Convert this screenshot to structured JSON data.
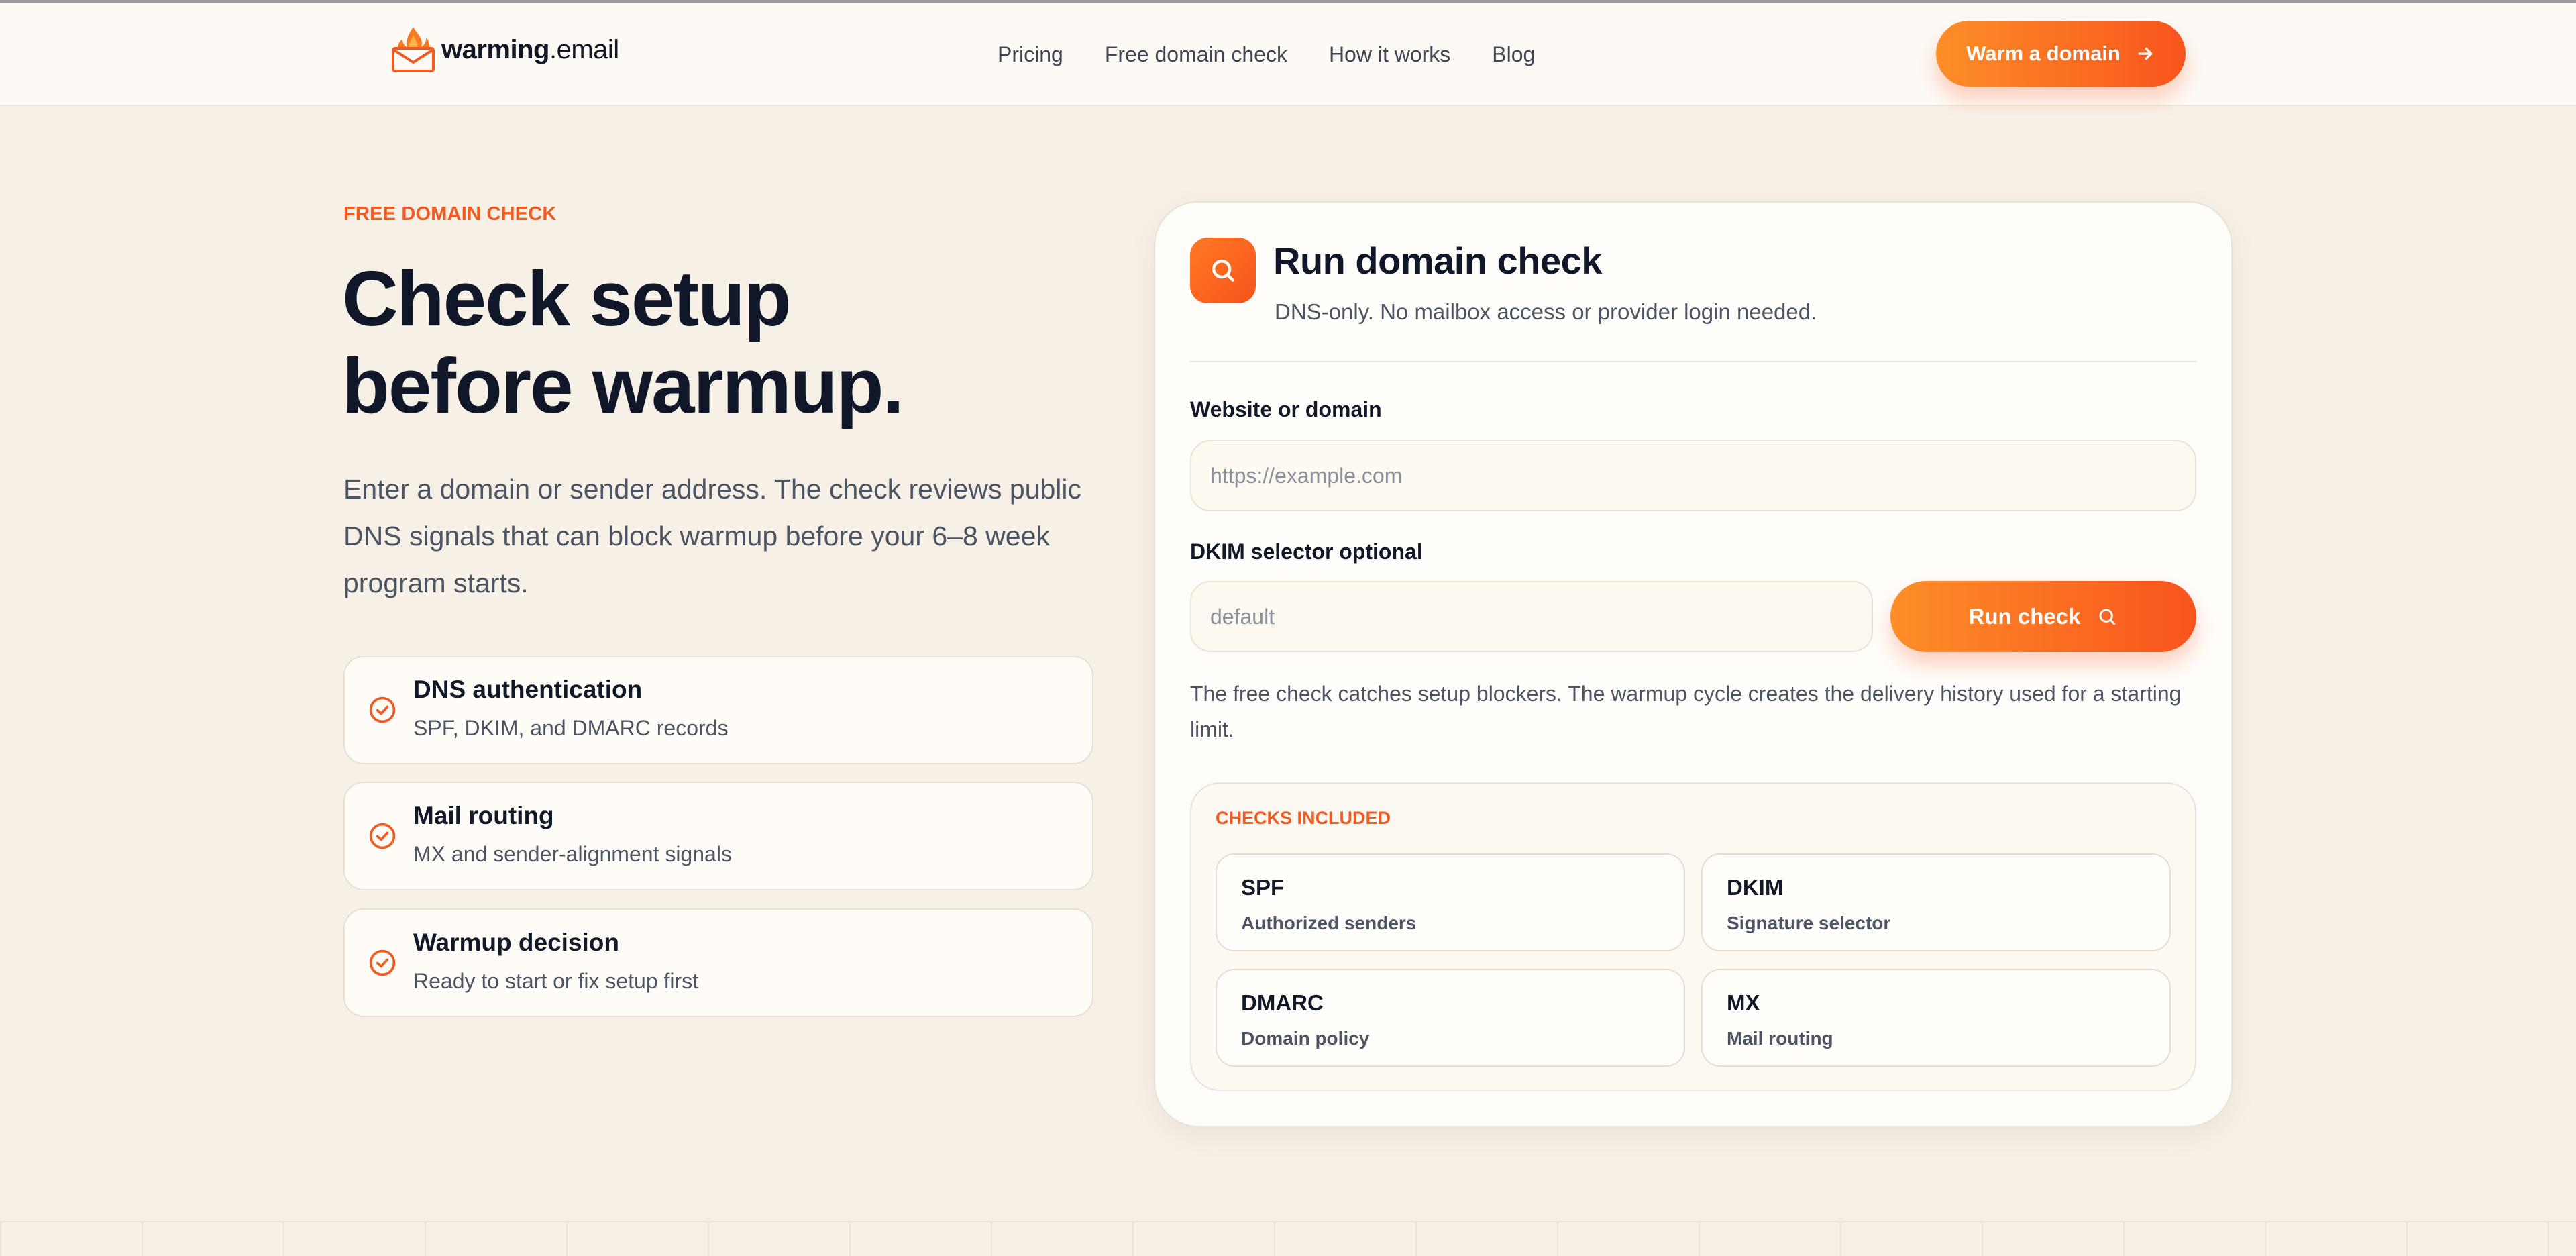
{
  "brand": {
    "name_bold": "warming",
    "name_rest": ".email",
    "accent": "#f9541d",
    "accent_light": "#fd8e28",
    "background": "#f7f0e7"
  },
  "nav": {
    "links": [
      "Pricing",
      "Free domain check",
      "How it works",
      "Blog"
    ],
    "cta_label": "Warm a domain",
    "cta_icon": "arrow-right-icon"
  },
  "hero": {
    "eyebrow": "FREE DOMAIN CHECK",
    "title_line1": "Check setup",
    "title_line2": "before warmup.",
    "subtitle": "Enter a domain or sender address. The check reviews public DNS signals that can block warmup before your 6–8 week program starts.",
    "features": [
      {
        "title": "DNS authentication",
        "desc": "SPF, DKIM, and DMARC records",
        "icon": "check-circle-icon"
      },
      {
        "title": "Mail routing",
        "desc": "MX and sender-alignment signals",
        "icon": "check-circle-icon"
      },
      {
        "title": "Warmup decision",
        "desc": "Ready to start or fix setup first",
        "icon": "check-circle-icon"
      }
    ]
  },
  "card": {
    "icon": "search-icon",
    "title": "Run domain check",
    "subtitle": "DNS-only. No mailbox access or provider login needed.",
    "domain_label": "Website or domain",
    "domain_placeholder": "https://example.com",
    "domain_value": "",
    "dkim_label": "DKIM selector optional",
    "dkim_placeholder": "default",
    "dkim_value": "",
    "run_label": "Run check",
    "note": "The free check catches setup blockers. The warmup cycle creates the delivery history used for a starting limit.",
    "checks_label": "CHECKS INCLUDED",
    "checks": [
      {
        "title": "SPF",
        "desc": "Authorized senders"
      },
      {
        "title": "DKIM",
        "desc": "Signature selector"
      },
      {
        "title": "DMARC",
        "desc": "Domain policy"
      },
      {
        "title": "MX",
        "desc": "Mail routing"
      }
    ]
  }
}
